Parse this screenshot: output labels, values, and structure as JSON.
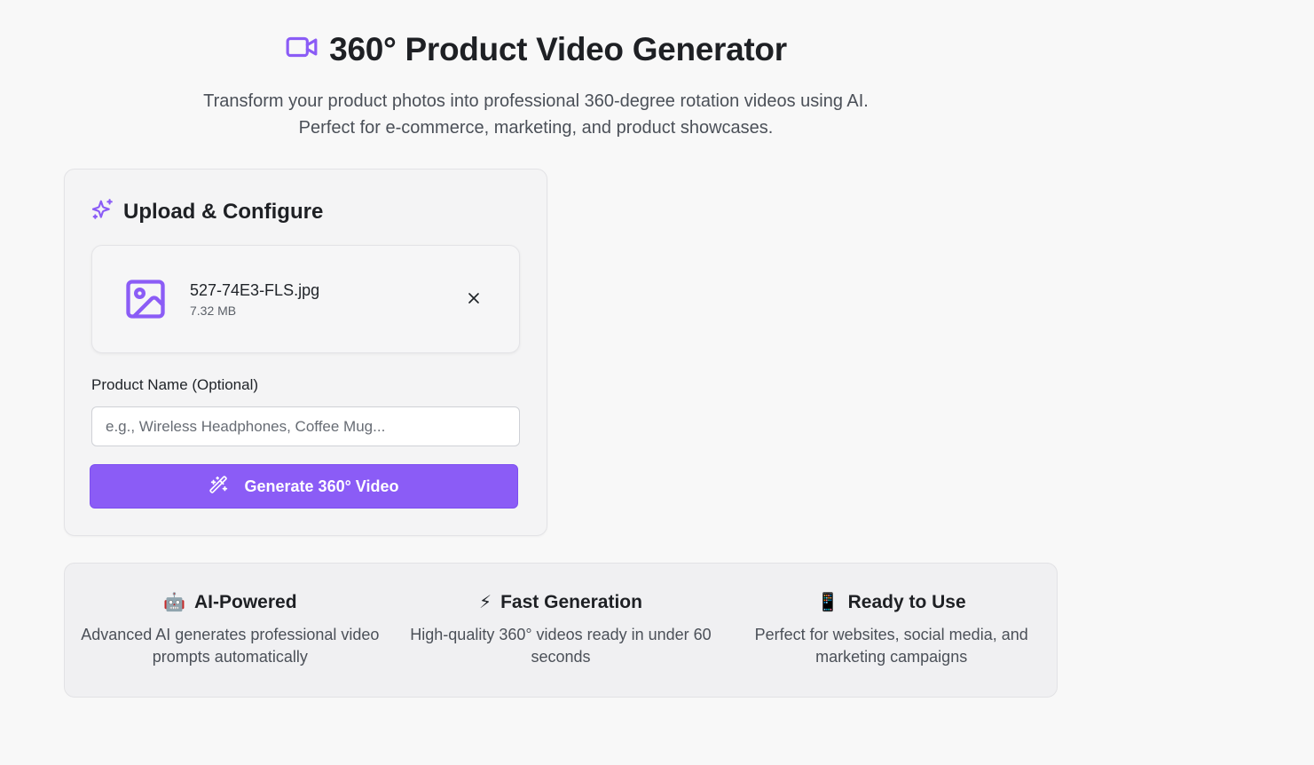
{
  "header": {
    "title": "360° Product Video Generator",
    "subtitle_line1": "Transform your product photos into professional 360-degree rotation videos using AI.",
    "subtitle_line2": "Perfect for e-commerce, marketing, and product showcases.",
    "icon": "video-camera-icon"
  },
  "upload": {
    "title": "Upload & Configure",
    "title_icon": "sparkles-icon",
    "file": {
      "name": "527-74E3-FLS.jpg",
      "size": "7.32 MB",
      "icon": "image-icon",
      "remove_icon": "close-icon"
    },
    "product_name": {
      "label": "Product Name (Optional)",
      "placeholder": "e.g., Wireless Headphones, Coffee Mug...",
      "value": ""
    },
    "generate_button": {
      "label": "Generate 360° Video",
      "icon": "magic-wand-icon"
    }
  },
  "features": [
    {
      "emoji": "🤖",
      "title": "AI-Powered",
      "description": "Advanced AI generates professional video prompts automatically"
    },
    {
      "emoji": "⚡",
      "title": "Fast Generation",
      "description": "High-quality 360° videos ready in under 60 seconds"
    },
    {
      "emoji": "📱",
      "title": "Ready to Use",
      "description": "Perfect for websites, social media, and marketing campaigns"
    }
  ],
  "colors": {
    "accent": "#8b5cf6",
    "background": "#f8f8f8",
    "card": "#f4f4f5"
  }
}
